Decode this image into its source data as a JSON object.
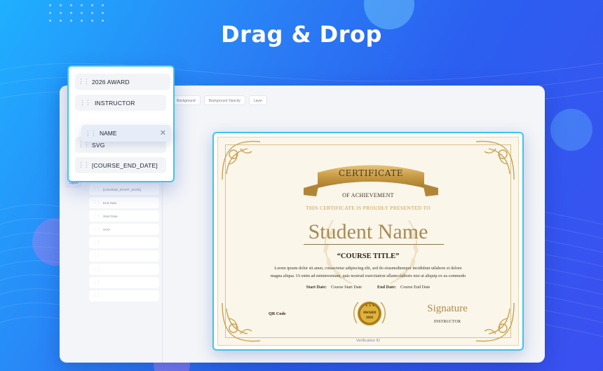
{
  "headline": "Drag & Drop",
  "editor": {
    "toolbar_chips": [
      "Background",
      "Background Opacity",
      "Layer"
    ],
    "rail_label": "Layers",
    "layer_items": [
      "[COURSE_START_DATE]",
      "End Date",
      "Start Date",
      "SVG",
      "",
      "",
      "",
      "",
      ""
    ]
  },
  "panel": {
    "items": [
      "2026 AWARD",
      "INSTRUCTOR",
      "SVG",
      "[COURSE_END_DATE]"
    ],
    "dragging_item": "NAME"
  },
  "certificate": {
    "ribbon_title": "CERTIFICATE",
    "subtitle": "OF ACHIEVEMENT",
    "presented_line": "THIS CERTIFICATE IS PROUDLY PRESENTED TO",
    "student_name": "Student Name",
    "course_title": "“COURSE TITLE”",
    "lorem_line1": "Lorem ipsum dolor sit amet, consectetur adipiscing elit, sed do eiusmodtempor incididunt utlabore et dolore",
    "lorem_line2": "magna aliqua. Ut enim ad minimveniam, quis nostrud exercitation ullamcolaboris nisi ut aliquip ex ea commodo",
    "start_label": "Start Date:",
    "start_value": "Course Start Date",
    "end_label": "End Date:",
    "end_value": "Course End Date",
    "qr_label": "QR Code",
    "seal_line1": "AWARD",
    "seal_line2": "2026",
    "signature": "Signature",
    "signature_role": "INSTRUCTOR",
    "verification": "Verification ID"
  },
  "colors": {
    "accent_border": "#39c7e8",
    "gold": "#c8a057",
    "background_blue": "#2b6ff2"
  }
}
